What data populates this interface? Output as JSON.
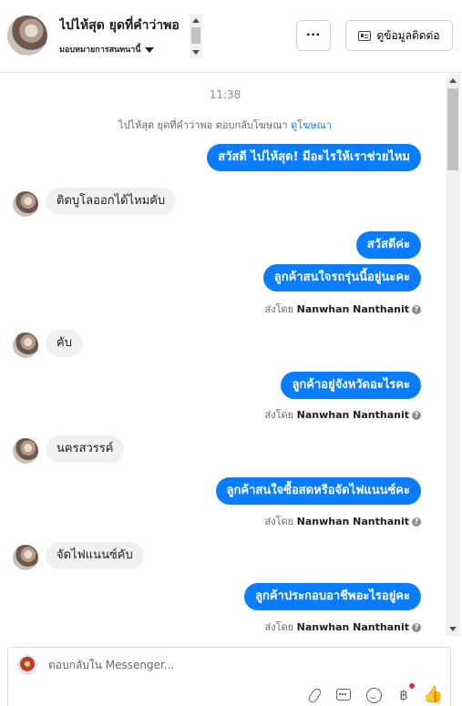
{
  "header": {
    "contact_name": "ไปไห้สุด ยุดที่คำว่าพอ",
    "assign_label": "มอบหมายการสนทนานี้",
    "more_label": "···",
    "contact_info_label": "ดูข้อมูลติดต่อ"
  },
  "conversation": {
    "timestamp": "11:38",
    "ad_reply_text": "ไปไห้สุด ยุดที่คำว่าพอ ตอบกลับโฆษณา",
    "ad_link_label": "ดูโฆษณา",
    "messages": [
      {
        "direction": "out",
        "text": "สวัสดี ไปไห้สุด! มีอะไรให้เราช่วยไหม"
      },
      {
        "direction": "in",
        "text": "ติดบูโลออกได้ไหมคับ"
      },
      {
        "direction": "out",
        "text": "สวัสดีค่ะ"
      },
      {
        "direction": "out",
        "text": "ลูกค้าสนใจรถรุ่นนี้อยู่นะคะ"
      },
      {
        "direction": "in",
        "text": "คับ"
      },
      {
        "direction": "out",
        "text": "ลูกค้าอยู่จังหวัดอะไรคะ"
      },
      {
        "direction": "in",
        "text": "นครสวรรค์"
      },
      {
        "direction": "out",
        "text": "ลูกค้าสนใจซื้อสดหรือจัดไฟแนนซ์คะ"
      },
      {
        "direction": "in",
        "text": "จัดไฟแนนซ์คับ"
      },
      {
        "direction": "out",
        "text": "ลูกค้าประกอบอาชีพอะไรอยู่คะ"
      }
    ],
    "sent_by_prefix": "ส่งโดย",
    "sent_by_name": "Nanwhan Nanthanit",
    "help_glyph": "?"
  },
  "composer": {
    "placeholder": "ตอบกลับใน Messenger...",
    "payment_glyph": "฿",
    "like_glyph": "👍"
  },
  "icons": [
    "caret-down-icon",
    "id-card-icon",
    "help-icon",
    "attach-icon",
    "saved-reply-icon",
    "emoji-icon",
    "payment-icon",
    "like-icon"
  ],
  "colors": {
    "outgoing_bubble": "#0a7cff",
    "incoming_bubble": "#f0f0f0",
    "link": "#1877f2",
    "notification_dot": "#f02849"
  }
}
